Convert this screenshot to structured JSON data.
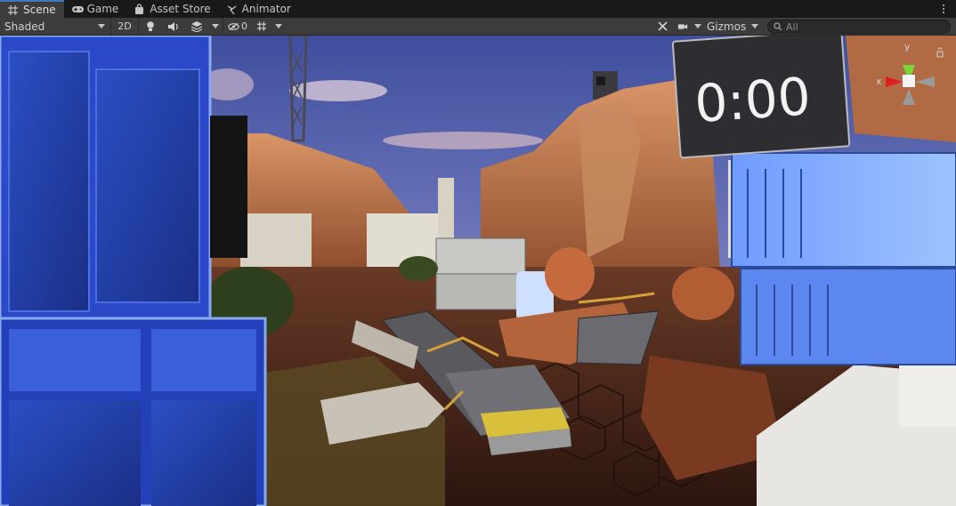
{
  "tabs": [
    {
      "label": "Scene",
      "icon": "hash-grid-icon",
      "active": true
    },
    {
      "label": "Game",
      "icon": "gamepad-icon",
      "active": false
    },
    {
      "label": "Asset Store",
      "icon": "shopping-bag-icon",
      "active": false
    },
    {
      "label": "Animator",
      "icon": "animator-icon",
      "active": false
    }
  ],
  "toolbar": {
    "draw_mode": "Shaded",
    "mode_2d": "2D",
    "hidden_count": "0",
    "gizmos_label": "Gizmos",
    "search_placeholder": "All"
  },
  "scene": {
    "timer_text": "0:00",
    "axis_y": "y",
    "axis_x": "x"
  },
  "colors": {
    "accent": "#3a79bb",
    "panel": "#3c3c3c",
    "dark": "#191919"
  }
}
